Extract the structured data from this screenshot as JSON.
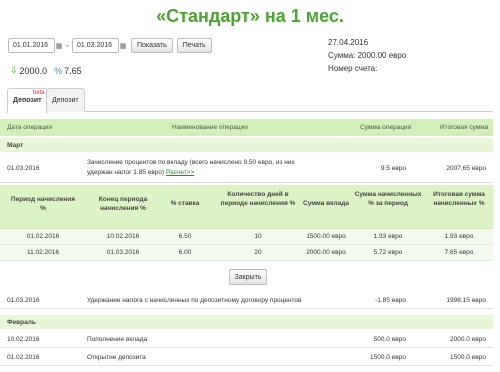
{
  "title": "«Стандарт» на 1 мес.",
  "filters": {
    "date_from": "01.01.2016",
    "date_to": "01.03.2016",
    "separator": "-",
    "show_label": "Показать",
    "print_label": "Печать"
  },
  "info": {
    "date": "27.04.2016",
    "sum": "Сумма: 2000.00 евро",
    "account": "Номер счета:"
  },
  "stats": {
    "amount": "2000.0",
    "rate": "7.65"
  },
  "tabs": [
    {
      "label": "Депозит",
      "badge": "beta"
    },
    {
      "label": "Депозит"
    }
  ],
  "table": {
    "headers": [
      "Дата операции",
      "Наименование операции",
      "Сумма операции",
      "Итоговая сумма"
    ],
    "groups": [
      {
        "label": "Март"
      },
      {
        "label": "Февраль"
      }
    ],
    "rows": [
      {
        "date": "01.03.2016",
        "name": "Зачисление процентов по вкладу (всего начислено 9.50 евро, из них удержан налог 1.85 евро)",
        "link": "Расчет>>",
        "amount": "9.5 евро",
        "total": "2007.65 евро"
      },
      {
        "date": "01.03.2016",
        "name": "Удержание налога с начисленных по депозитному договору процентов",
        "amount": "-1.85 евро",
        "total": "1998.15 евро"
      },
      {
        "date": "10.02.2016",
        "name": "Пополнение вклада",
        "amount": "500.0 евро",
        "total": "2000.0 евро"
      },
      {
        "date": "01.02.2016",
        "name": "Открытие депозита",
        "amount": "1500.0 евро",
        "total": "1500.0 евро"
      }
    ]
  },
  "calc": {
    "headers": [
      "Период начисления %",
      "Конец периода начисления %",
      "% ставка",
      "Количество дней в периоде начисления %",
      "Сумма вклада",
      "Сумма начисленных % за период",
      "Итоговая сумма начисленных %"
    ],
    "rows": [
      [
        "01.02.2016",
        "10.02.2016",
        "6.50",
        "10",
        "1500.00 евро",
        "1.93 евро",
        "1.93 евро"
      ],
      [
        "11.02.2016",
        "01.03.2016",
        "6.00",
        "20",
        "2000.00 евро",
        "5.72 евро",
        "7.65 евро"
      ]
    ],
    "button_label": "Закрыть"
  }
}
